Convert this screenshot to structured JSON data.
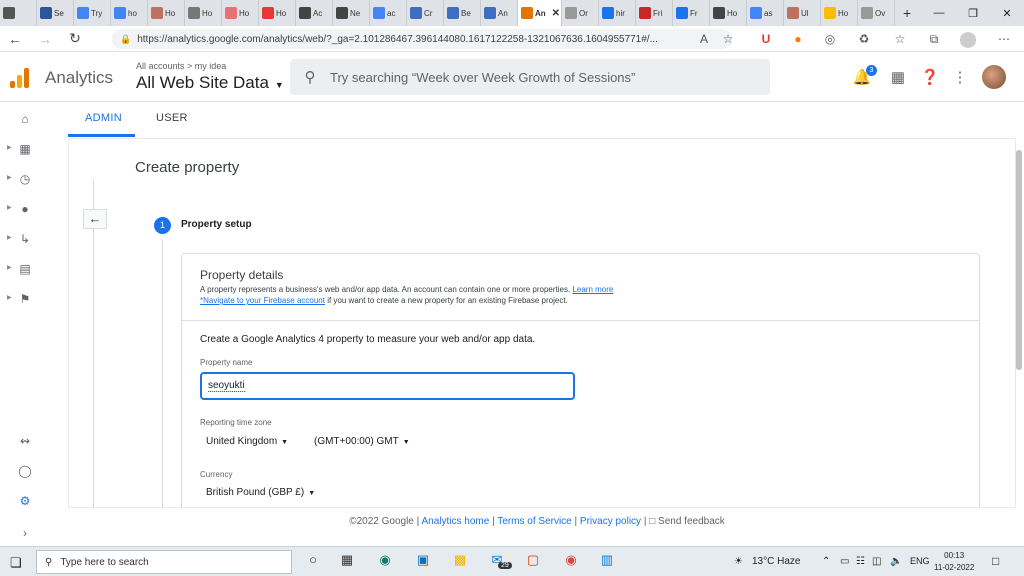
{
  "browser": {
    "tabs": [
      {
        "label": "",
        "color": "#555"
      },
      {
        "label": "Se",
        "color": "#2b579a"
      },
      {
        "label": "Try",
        "color": "#4285f4"
      },
      {
        "label": "ho",
        "color": "#4285f4"
      },
      {
        "label": "Ho",
        "color": "#c07060"
      },
      {
        "label": "Ho",
        "color": "#777"
      },
      {
        "label": "Ho",
        "color": "#e57373"
      },
      {
        "label": "Ho",
        "color": "#e53935"
      },
      {
        "label": "Ac",
        "color": "#444"
      },
      {
        "label": "Ne",
        "color": "#444"
      },
      {
        "label": "ac",
        "color": "#4285f4"
      },
      {
        "label": "Cr",
        "color": "#3f6ec1"
      },
      {
        "label": "Be",
        "color": "#3f6ec1"
      },
      {
        "label": "An",
        "color": "#3f6ec1"
      },
      {
        "label": "An",
        "color": "#e37400",
        "active": true
      },
      {
        "label": "Or",
        "color": "#999"
      },
      {
        "label": "hir",
        "color": "#1a73e8"
      },
      {
        "label": "Fri",
        "color": "#c62828"
      },
      {
        "label": "Fr",
        "color": "#1a73e8"
      },
      {
        "label": "Ho",
        "color": "#444"
      },
      {
        "label": "as",
        "color": "#4285f4"
      },
      {
        "label": "Ul",
        "color": "#c07060"
      },
      {
        "label": "Ho",
        "color": "#fbbc04"
      },
      {
        "label": "Ov",
        "color": "#999"
      }
    ],
    "new_tab": "+",
    "url": "https://analytics.google.com/analytics/web/?_ga=2.101286467.396144080.1617122258-1321067636.1604955771#/..."
  },
  "header": {
    "app_title": "Analytics",
    "breadcrumb": "All accounts > my idea",
    "view_name": "All Web Site Data",
    "search_placeholder": "Try searching “Week over Week Growth of Sessions”",
    "notification_count": "3"
  },
  "admin_tabs": {
    "admin": "ADMIN",
    "user": "USER"
  },
  "page": {
    "title": "Create property",
    "step_number": "1",
    "step_title": "Property setup",
    "card_title": "Property details",
    "desc_line1": "A property represents a business's web and/or app data. An account can contain one or more properties.",
    "learn_more": "Learn more",
    "firebase_link": "*Navigate to your Firebase account",
    "desc_line2_rest": " if you want to create a new property for an existing Firebase project.",
    "intro": "Create a Google Analytics 4 property to measure your web and/or app data.",
    "property_name_label": "Property name",
    "property_name_value": "seoyukti",
    "timezone_label": "Reporting time zone",
    "timezone_country": "United Kingdom",
    "timezone_offset": "(GMT+00:00) GMT",
    "currency_label": "Currency",
    "currency_value": "British Pound (GBP £)"
  },
  "footer": {
    "copyright": "©2022 Google",
    "analytics_home": "Analytics home",
    "terms": "Terms of Service",
    "privacy": "Privacy policy",
    "feedback": "Send feedback",
    "sep": " | "
  },
  "taskbar": {
    "search_placeholder": "Type here to search",
    "mail_count": "29",
    "weather": "13°C  Haze",
    "lang": "ENG",
    "time": "00:13",
    "date": "11-02-2022"
  }
}
